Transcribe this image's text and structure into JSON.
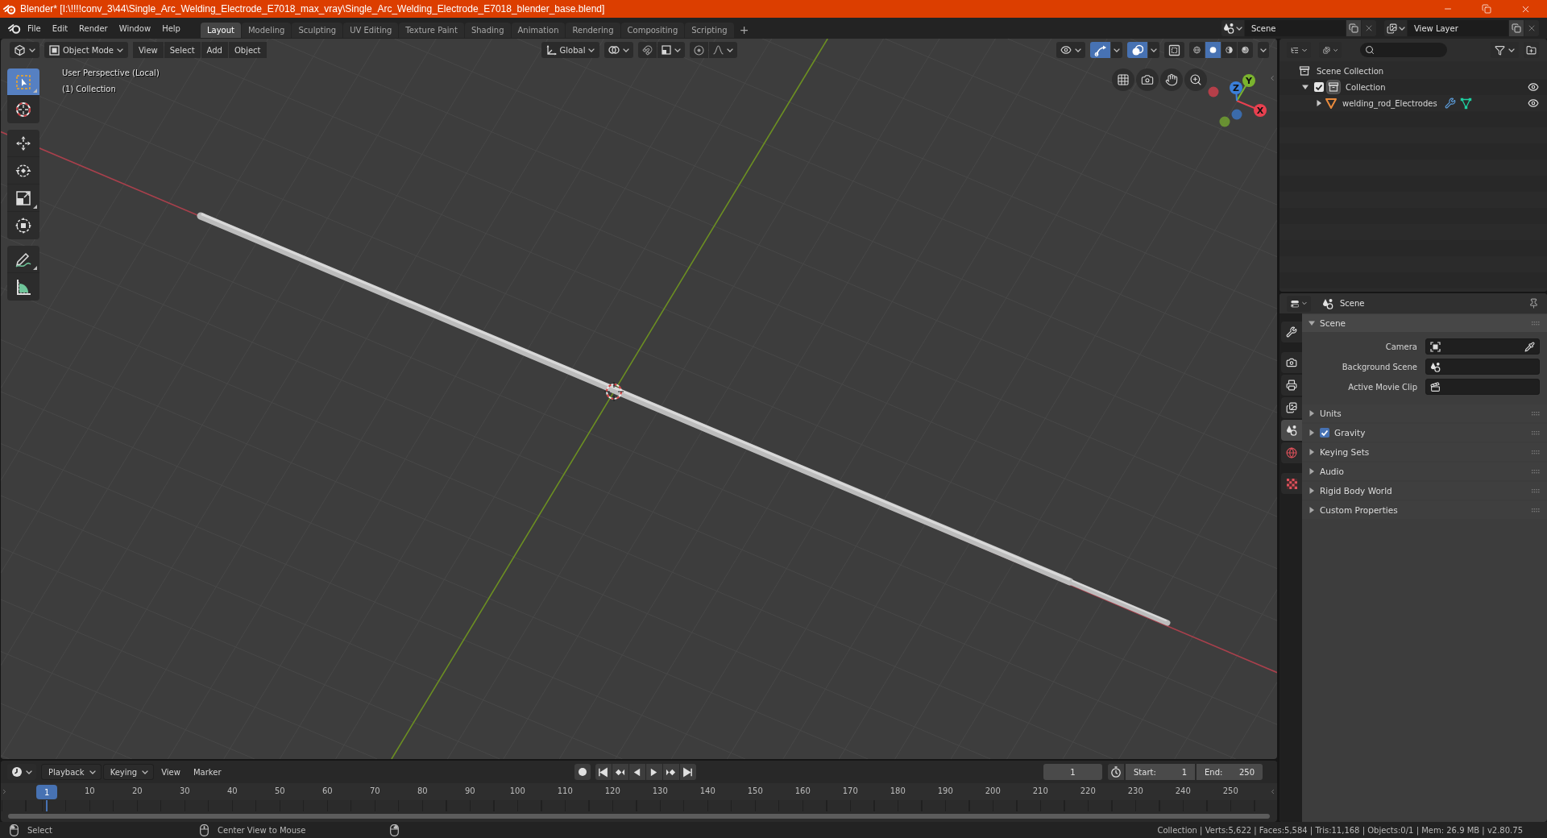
{
  "title_bar": {
    "title": "Blender* [I:\\!!!!conv_3\\44\\Single_Arc_Welding_Electrode_E7018_max_vray\\Single_Arc_Welding_Electrode_E7018_blender_base.blend]"
  },
  "top_bar": {
    "menus": [
      "File",
      "Edit",
      "Render",
      "Window",
      "Help"
    ],
    "workspaces": [
      {
        "label": "Layout",
        "selected": true
      },
      {
        "label": "Modeling",
        "selected": false
      },
      {
        "label": "Sculpting",
        "selected": false
      },
      {
        "label": "UV Editing",
        "selected": false
      },
      {
        "label": "Texture Paint",
        "selected": false
      },
      {
        "label": "Shading",
        "selected": false
      },
      {
        "label": "Animation",
        "selected": false
      },
      {
        "label": "Rendering",
        "selected": false
      },
      {
        "label": "Compositing",
        "selected": false
      },
      {
        "label": "Scripting",
        "selected": false
      }
    ],
    "add_workspace": "+",
    "scene": "Scene",
    "view_layer": "View Layer"
  },
  "viewport": {
    "header": {
      "mode": "Object Mode",
      "menus": [
        "View",
        "Select",
        "Add",
        "Object"
      ],
      "orientation": "Global",
      "toggles": [
        {
          "kind": "gizmos",
          "on": true
        },
        {
          "kind": "overlays",
          "on": true
        },
        {
          "kind": "xray",
          "on": false
        }
      ],
      "shading": [
        {
          "kind": "wireframe",
          "selected": false
        },
        {
          "kind": "solid",
          "selected": true
        },
        {
          "kind": "material",
          "selected": false
        },
        {
          "kind": "rendered",
          "selected": false
        }
      ]
    },
    "overlay_text": [
      "User Perspective (Local)",
      "(1) Collection"
    ],
    "tool_groups": [
      [
        {
          "kind": "select",
          "selected": true,
          "variants": true
        },
        {
          "kind": "cursor",
          "selected": false,
          "variants": false
        }
      ],
      [
        {
          "kind": "move",
          "selected": false,
          "variants": false
        },
        {
          "kind": "rotate",
          "selected": false,
          "variants": false
        },
        {
          "kind": "scale",
          "selected": false,
          "variants": true
        },
        {
          "kind": "transform",
          "selected": false,
          "variants": false
        }
      ],
      [
        {
          "kind": "annotate",
          "selected": false,
          "variants": true
        },
        {
          "kind": "measure",
          "selected": false,
          "variants": false
        }
      ]
    ],
    "gizmo_axes": [
      {
        "label": "X",
        "color": "#e8404f"
      },
      {
        "label": "Y",
        "color": "#7ab32e"
      },
      {
        "label": "Z",
        "color": "#3b7fd9"
      }
    ]
  },
  "outliner": {
    "items": [
      {
        "label": "Scene Collection",
        "kind": "scene_collection",
        "active": false,
        "children": [
          {
            "label": "Collection",
            "kind": "collection",
            "active": true,
            "expanded": true,
            "checked": true,
            "visible": true,
            "children": [
              {
                "label": "welding_rod_Electrodes",
                "kind": "mesh_object",
                "active": false,
                "expanded": false,
                "visible": true
              }
            ]
          }
        ]
      }
    ]
  },
  "properties": {
    "title": "Scene",
    "tab_groups": [
      [
        {
          "kind": "tool",
          "selected": false
        }
      ],
      [
        {
          "kind": "render",
          "selected": false
        },
        {
          "kind": "output",
          "selected": false
        },
        {
          "kind": "view_layer",
          "selected": false
        },
        {
          "kind": "scene",
          "selected": true
        },
        {
          "kind": "world",
          "selected": false
        }
      ],
      [
        {
          "kind": "texture",
          "selected": false
        }
      ]
    ],
    "panels": [
      {
        "title": "Scene",
        "expanded": true,
        "fields": [
          {
            "label": "Camera",
            "kind": "camera"
          },
          {
            "label": "Background Scene",
            "kind": "scene"
          },
          {
            "label": "Active Movie Clip",
            "kind": "clip"
          }
        ]
      },
      {
        "title": "Units",
        "expanded": false
      },
      {
        "title": "Gravity",
        "expanded": false,
        "checked": true
      },
      {
        "title": "Keying Sets",
        "expanded": false
      },
      {
        "title": "Audio",
        "expanded": false
      },
      {
        "title": "Rigid Body World",
        "expanded": false
      },
      {
        "title": "Custom Properties",
        "expanded": false
      }
    ]
  },
  "timeline": {
    "menus": [
      {
        "label": "Playback",
        "dropdown": true
      },
      {
        "label": "Keying",
        "dropdown": true
      },
      {
        "label": "View",
        "dropdown": false
      },
      {
        "label": "Marker",
        "dropdown": false
      }
    ],
    "current_frame": "1",
    "start": {
      "label": "Start:",
      "value": "1"
    },
    "end": {
      "label": "End:",
      "value": "250"
    },
    "playhead": "1",
    "frame_labels": [
      "10",
      "20",
      "30",
      "40",
      "50",
      "60",
      "70",
      "80",
      "90",
      "100",
      "110",
      "120",
      "130",
      "140",
      "150",
      "160",
      "170",
      "180",
      "190",
      "200",
      "210",
      "220",
      "230",
      "240",
      "250"
    ]
  },
  "status_bar": {
    "hints": [
      {
        "kind": "left_click",
        "label": "Select"
      },
      {
        "kind": "middle_click",
        "label": "Center View to Mouse"
      },
      {
        "kind": "right_click"
      }
    ],
    "stats": "Collection | Verts:5,622 | Faces:5,584 | Tris:11,168 | Objects:0/1 | Mem: 26.9 MB | v2.80.75"
  }
}
